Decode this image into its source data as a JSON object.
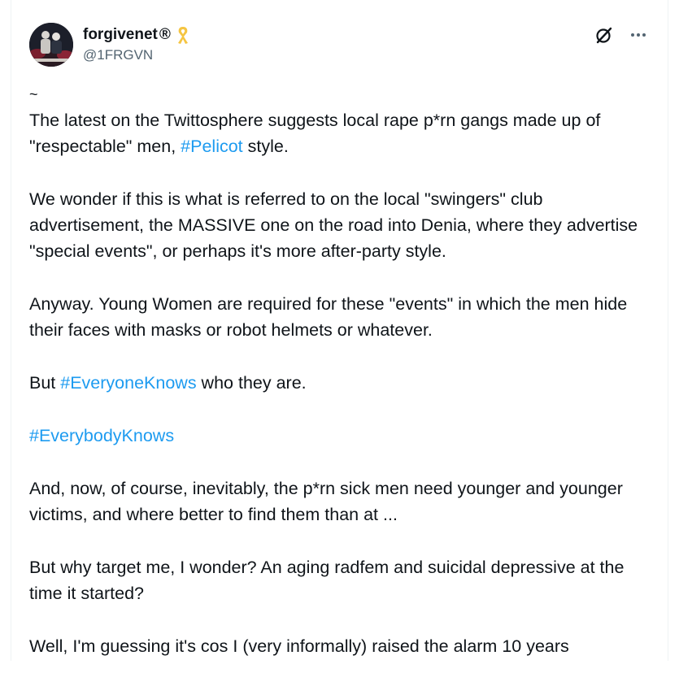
{
  "user": {
    "display_name": "forgivenet",
    "reg_mark": "®",
    "handle": "@1FRGVN",
    "ribbon_color": "#f5c542"
  },
  "icons": {
    "grok": "grok-icon",
    "more": "more-icon",
    "ribbon": "ribbon-icon"
  },
  "tweet": {
    "tilde": "~",
    "p1_text": "The latest on the Twittosphere suggests local rape p*rn gangs made up of \"respectable\" men, ",
    "p1_tag": "#Pelicot",
    "p1_end": " style.",
    "p2": "We wonder if this is what is referred to on the local \"swingers\" club advertisement, the MASSIVE one on the road into Denia, where they advertise \"special events\", or perhaps it's more after-party style.",
    "p3": "Anyway. Young Women are required for these \"events\" in which the men hide their faces with masks or robot helmets or whatever.",
    "p4_start": "But ",
    "p4_tag": "#EveryoneKnows",
    "p4_end": " who they are.",
    "p5_tag": "#EverybodyKnows",
    "p6": "And, now, of course, inevitably, the p*rn sick men need younger and younger victims, and where better to find them than at ...",
    "p7": "But why target me, I wonder? An aging radfem and suicidal depressive at the time it started?",
    "p8": "Well, I'm guessing it's cos I (very informally) raised the alarm 10 years"
  },
  "colors": {
    "link": "#1d9bf0",
    "secondary": "#536471",
    "text": "#0f1419"
  }
}
